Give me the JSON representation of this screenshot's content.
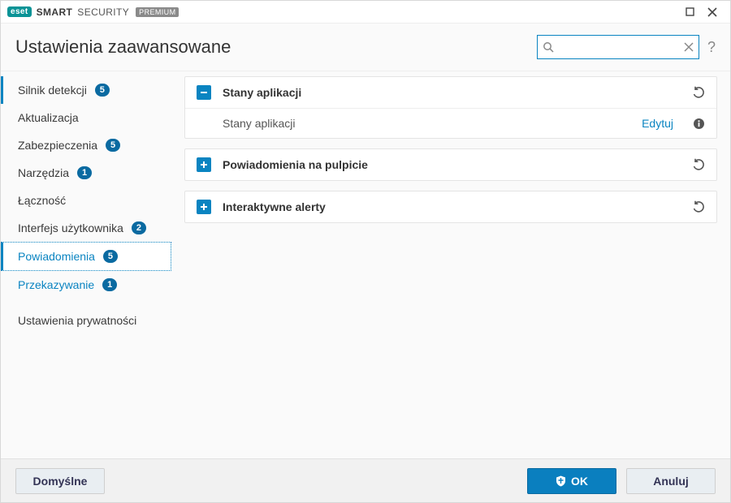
{
  "brand": {
    "badge": "eset",
    "name_strong": "SMART",
    "name_light": "SECURITY",
    "tier": "PREMIUM"
  },
  "header": {
    "title": "Ustawienia zaawansowane",
    "search_placeholder": ""
  },
  "sidebar": {
    "items": [
      {
        "label": "Silnik detekcji",
        "badge": "5"
      },
      {
        "label": "Aktualizacja",
        "badge": null
      },
      {
        "label": "Zabezpieczenia",
        "badge": "5"
      },
      {
        "label": "Narzędzia",
        "badge": "1"
      },
      {
        "label": "Łączność",
        "badge": null
      },
      {
        "label": "Interfejs użytkownika",
        "badge": "2"
      },
      {
        "label": "Powiadomienia",
        "badge": "5"
      },
      {
        "label": "Przekazywanie",
        "badge": "1"
      },
      {
        "label": "Ustawienia prywatności",
        "badge": null
      }
    ]
  },
  "sections": [
    {
      "title": "Stany aplikacji",
      "expanded": true,
      "rows": [
        {
          "label": "Stany aplikacji",
          "action": "Edytuj"
        }
      ]
    },
    {
      "title": "Powiadomienia na pulpicie",
      "expanded": false
    },
    {
      "title": "Interaktywne alerty",
      "expanded": false
    }
  ],
  "footer": {
    "default": "Domyślne",
    "ok": "OK",
    "cancel": "Anuluj"
  },
  "colors": {
    "accent": "#0a84c1",
    "badge": "#0a6aa1"
  }
}
